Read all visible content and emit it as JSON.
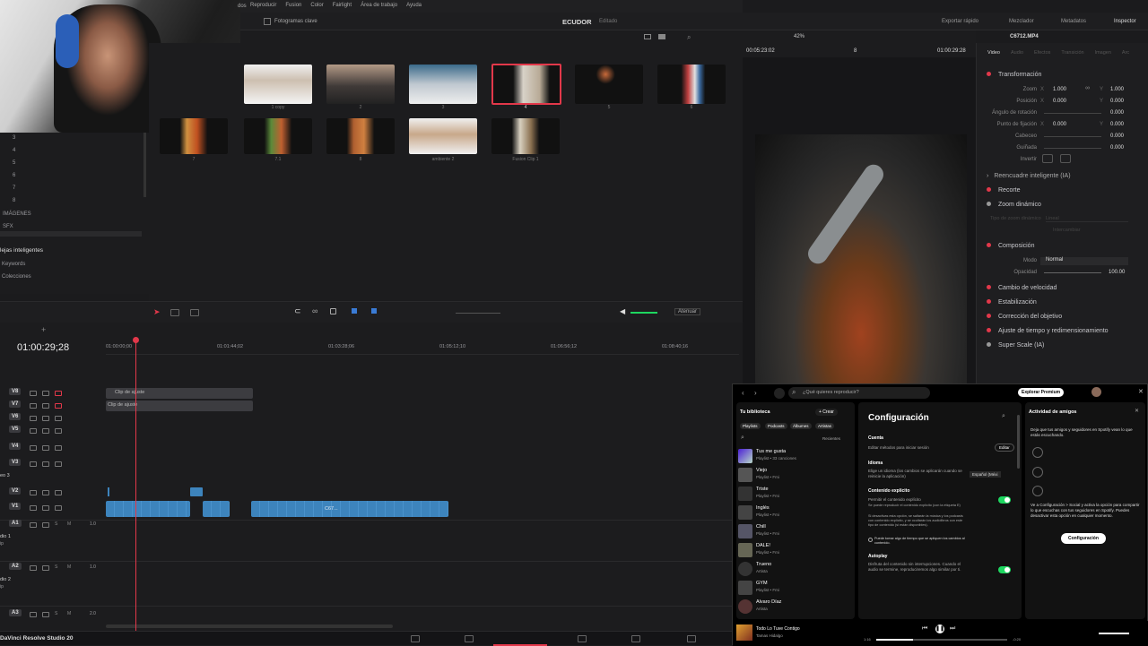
{
  "menu": [
    "Reproducir",
    "Fusion",
    "Color",
    "Fairlight",
    "Área de trabajo",
    "Ayuda"
  ],
  "menu_left_fragment": "dos",
  "keyframes_label": "Fotogramas clave",
  "project_title": "ECUDOR",
  "project_state": "Editado",
  "top_right": {
    "quick_export": "Exportar rápido",
    "mixer": "Mezclador",
    "metadata": "Metadatos",
    "inspector": "Inspector"
  },
  "viewer": {
    "zoom": "42%",
    "left_tc": "00:05:23:02",
    "right_tc": "01:00:29:28",
    "clip_name": "C6712.MP4",
    "frame_num": "8"
  },
  "media_clips": [
    {
      "label": "1 copy"
    },
    {
      "label": "2"
    },
    {
      "label": "3"
    },
    {
      "label": "4"
    },
    {
      "label": "5"
    },
    {
      "label": "6"
    },
    {
      "label": "7"
    },
    {
      "label": "7.1"
    },
    {
      "label": "8"
    },
    {
      "label": "ambiente 2"
    },
    {
      "label": "Fusion Clip 1"
    }
  ],
  "bins": {
    "numbers": [
      "3",
      "4",
      "5",
      "6",
      "7",
      "8"
    ],
    "imagenes": "IMÁGENES",
    "sfx": "SFX",
    "smart": "lejas inteligentes",
    "keywords": "Keywords",
    "colecciones": "Colecciones"
  },
  "edit_toolbar": {
    "atenuar": "Atenuar"
  },
  "timeline": {
    "timecode": "01:00:29;28",
    "ruler": [
      "01:00:00;00",
      "01:01:44;02",
      "01:03:28;06",
      "01:05:12;10",
      "01:06:56;12",
      "01:08:40;16"
    ],
    "video_tracks": [
      "V8",
      "V7",
      "V6",
      "V5",
      "V4",
      "V3",
      "V2",
      "V1"
    ],
    "audio_tracks": [
      {
        "id": "A1",
        "vol": "1.0",
        "name": "dio 1",
        "sub": "ip"
      },
      {
        "id": "A2",
        "vol": "1.0",
        "name": "dio 2",
        "sub": "ip"
      },
      {
        "id": "A3",
        "vol": "2.0",
        "name": "",
        "sub": ""
      }
    ],
    "v8_clip": "Clip de ajuste",
    "v7_clip": "Clip de ajuste",
    "v3_name": "eo 3",
    "v1_clip": "C67..."
  },
  "app_name": "DaVinci Resolve Studio 20",
  "inspector": {
    "tabs": [
      "Video",
      "Audio",
      "Efectos",
      "Transición",
      "Imagen",
      "Arc"
    ],
    "transform": "Transformación",
    "rows": [
      {
        "label": "Zoom",
        "x": "1.000",
        "y": "1.000"
      },
      {
        "label": "Posición",
        "x": "0.000",
        "y": "0.000"
      },
      {
        "label": "Ángulo de rotación",
        "v": "0.000"
      },
      {
        "label": "Punto de fijación",
        "x": "0.000",
        "y": "0.000"
      },
      {
        "label": "Cabeceo",
        "v": "0.000"
      },
      {
        "label": "Guiñada",
        "v": "0.000"
      },
      {
        "label": "Invertir",
        "v": ""
      }
    ],
    "reframe": "Reencuadre inteligente (IA)",
    "crop": "Recorte",
    "dyn_zoom": "Zoom dinámico",
    "dyn_sub": "Tipo de zoom dinámico",
    "dyn_val": "Lineal",
    "dyn_swap": "Intercambiar",
    "composite": "Composición",
    "mode_label": "Modo",
    "mode_val": "Normal",
    "opacity_label": "Opacidad",
    "opacity_val": "100.00",
    "sections": [
      "Cambio de velocidad",
      "Estabilización",
      "Corrección del objetivo",
      "Ajuste de tiempo y redimensionamiento",
      "Super Scale (IA)"
    ],
    "x_lbl": "X",
    "y_lbl": "Y"
  },
  "spotify": {
    "search_ph": "¿Qué quieres reproducir?",
    "premium": "Explorar Premium",
    "library": "Tu biblioteca",
    "create": "+ Crear",
    "filters": [
      "Playlists",
      "Podcasts",
      "Álbumes",
      "Artistas"
    ],
    "recent": "Recientes",
    "items": [
      {
        "t": "Tus me gusta",
        "s": "Playlist • 33 canciones",
        "c": "#7b4dff"
      },
      {
        "t": "Viejo",
        "s": "Playlist • Fmi",
        "c": "#555"
      },
      {
        "t": "Triste",
        "s": "Playlist • Fmi",
        "c": "#333"
      },
      {
        "t": "Inglés",
        "s": "Playlist • Fmi",
        "c": "#444"
      },
      {
        "t": "Chill",
        "s": "Playlist • Fmi",
        "c": "#556"
      },
      {
        "t": "DALE!",
        "s": "Playlist • Fmi",
        "c": "#665"
      },
      {
        "t": "Trueno",
        "s": "Artista",
        "c": "#333"
      },
      {
        "t": "GYM",
        "s": "Playlist • Fmi",
        "c": "#444"
      },
      {
        "t": "Alvaro Díaz",
        "s": "Artista",
        "c": "#533"
      }
    ],
    "settings": "Configuración",
    "account": "Cuenta",
    "account_desc": "Editar métodos para iniciar sesión",
    "edit": "Editar",
    "language": "Idioma",
    "language_desc": "Elige un idioma (los cambios se aplicarán cuando se reinicie la aplicación)",
    "language_val": "Español (Méxi",
    "explicit": "Contenido explícito",
    "explicit_desc": "Permitir el contenido explícito",
    "explicit_note1": "Se puede reproducir el contenido explícito (con la etiqueta E)",
    "explicit_note2": "Si desactivas esta opción, se saltarán la música y los podcasts con contenido explícito, y se ocultarán los audiolibros con este tipo de contenido (si están disponibles).",
    "explicit_note3": "Puede tomar algo de tiempo que se apliquen los cambios al contenido.",
    "autoplay": "Autoplay",
    "autoplay_desc": "Disfruta del contenido sin interrupciones. Cuando el audio se termine, reproduciremos algo similar por ti.",
    "friends": "Actividad de amigos",
    "friends_desc": "Deja que tus amigos y seguidores en Spotify vean lo que estás escuchando.",
    "friends_desc2": "Ve a Configuración > Social y activa la opción para compartir lo que escuchas con tus seguidores en Spotify. Puedes desactivar esta opción en cualquier momento.",
    "friends_btn": "Configuración",
    "np_title": "Todo Lo Tuve Contigo",
    "np_artist": "Tamas Hidalgo",
    "np_elapsed": "1:16",
    "np_total": "-0:20",
    "np_progress": 0.28
  },
  "colors": {
    "accent": "#e2384a",
    "spotify_green": "#1ed760",
    "clip_blue": "#3d84bd"
  },
  "icons": [
    "search-icon",
    "home-icon",
    "play-icon",
    "pause-icon",
    "gear-icon",
    "close-icon"
  ]
}
